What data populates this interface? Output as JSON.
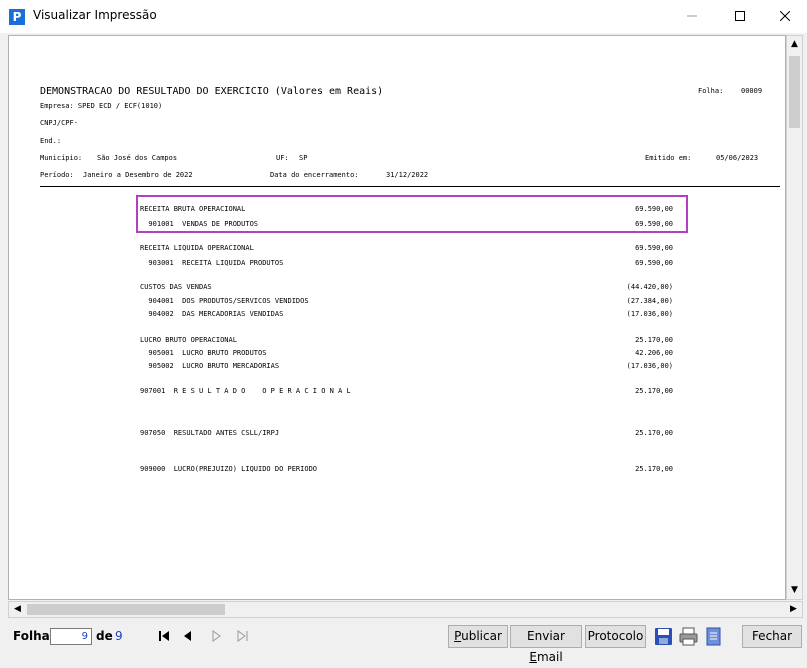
{
  "window": {
    "title": "Visualizar Impressão",
    "app_icon_letter": "P",
    "controls": [
      "minimize-icon",
      "maximize-icon",
      "close-icon"
    ]
  },
  "report": {
    "title": "DEMONSTRACAO DO RESULTADO DO EXERCICIO (Valores em Reais)",
    "folha_label": "Folha:",
    "folha_value": "00009",
    "empresa": "Empresa: SPED ECD / ECF(1010)",
    "cnpj": "CNPJ/CPF·",
    "end": "End.:",
    "municipio_label": "Município:",
    "municipio_value": "São José dos Campos",
    "uf_label": "UF:",
    "uf_value": "SP",
    "emitido_label": "Emitido em:",
    "emitido_value": "05/06/2023",
    "periodo_label": "Período:",
    "periodo_value": "Janeiro a Desembro de 2022",
    "encerramento_label": "Data do encerramento:",
    "encerramento_value": "31/12/2022",
    "lines": [
      {
        "text": "RECEITA BRUTA OPERACIONAL",
        "amount": "69.590,00"
      },
      {
        "text": "  901001  VENDAS DE PRODUTOS",
        "amount": "69.590,00"
      },
      {
        "text": "RECEITA LIQUIDA OPERACIONAL",
        "amount": "69.590,00"
      },
      {
        "text": "  903001  RECEITA LIQUIDA PRODUTOS",
        "amount": "69.590,00"
      },
      {
        "text": "CUSTOS DAS VENDAS",
        "amount": "(44.420,00)"
      },
      {
        "text": "  904001  DOS PRODUTOS/SERVICOS VENDIDOS",
        "amount": "(27.384,00)"
      },
      {
        "text": "  904002  DAS MERCADORIAS VENDIDAS",
        "amount": "(17.036,00)"
      },
      {
        "text": "LUCRO BRUTO OPERACIONAL",
        "amount": "25.170,00"
      },
      {
        "text": "  905001  LUCRO BRUTO PRODUTOS",
        "amount": "42.206,00"
      },
      {
        "text": "  905002  LUCRO BRUTO MERCADORIAS",
        "amount": "(17.036,00)"
      },
      {
        "text": "907001  R E S U L T A D O    O P E R A C I O N A L",
        "amount": "25.170,00"
      },
      {
        "text": "907050  RESULTADO ANTES CSLL/IRPJ",
        "amount": "25.170,00"
      },
      {
        "text": "909000  LUCRO(PREJUIZO) LIQUIDO DO PERIODO",
        "amount": "25.170,00"
      }
    ],
    "highlight_color": "#b43fc0"
  },
  "toolbar": {
    "folha_label": "Folha",
    "page_current": "9",
    "de_label": "de",
    "page_total": "9",
    "publicar": "ublicar",
    "publicar_mnemonic": "P",
    "enviar_prefix": "Enviar ",
    "enviar_mnemonic": "E",
    "enviar_suffix": "mail",
    "protocolo": "Protocolo",
    "fechar": "Fechar"
  }
}
